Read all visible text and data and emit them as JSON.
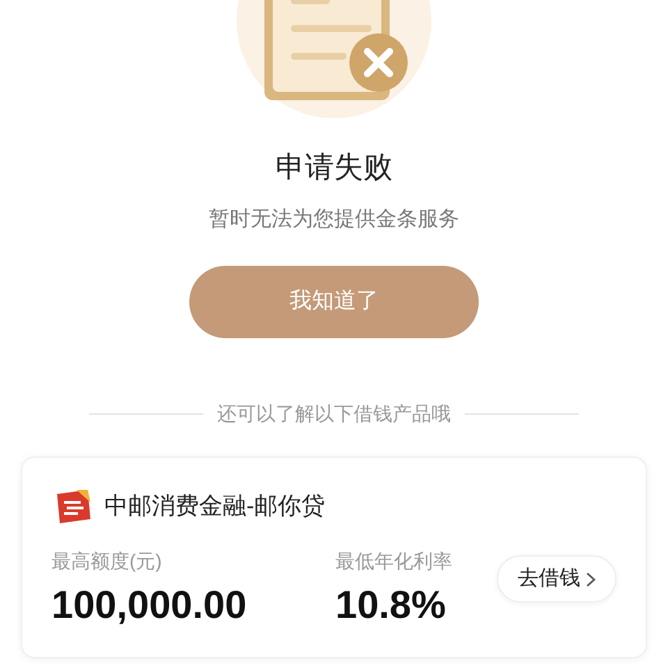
{
  "result": {
    "title": "申请失败",
    "message": "暂时无法为您提供金条服务",
    "button": "我知道了"
  },
  "divider_text": "还可以了解以下借钱产品哦",
  "products": [
    {
      "name": "中邮消费金融-邮你贷",
      "limit_label": "最高额度(元)",
      "limit_value": "100,000.00",
      "rate_label": "最低年化利率",
      "rate_value": "10.8%",
      "action": "去借钱"
    }
  ]
}
